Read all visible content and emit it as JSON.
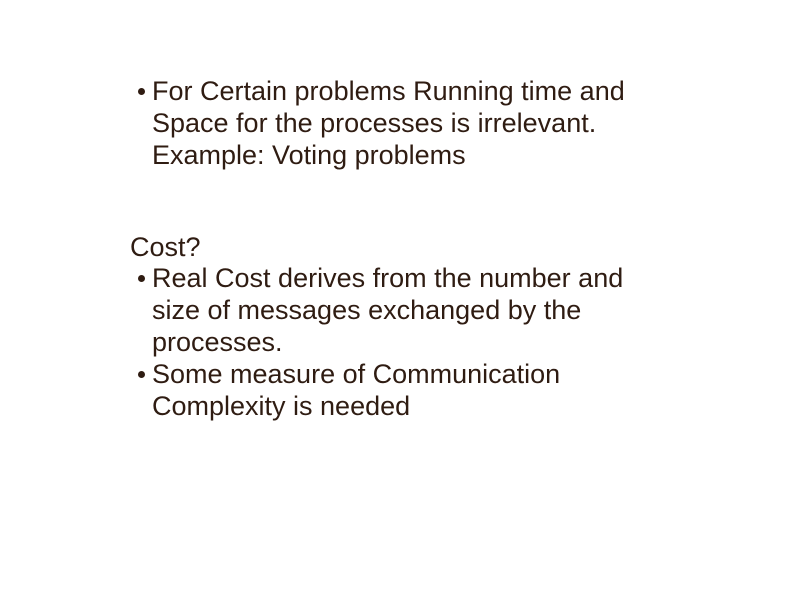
{
  "top": {
    "bullet1": "For Certain problems Running time and Space for the processes is irrelevant.",
    "hanging1": "Example: Voting problems"
  },
  "bottom": {
    "heading": "Cost?",
    "bullet1": "Real Cost derives from the number and size of messages exchanged by the processes.",
    "bullet2": "Some measure of Communication Complexity is needed"
  }
}
